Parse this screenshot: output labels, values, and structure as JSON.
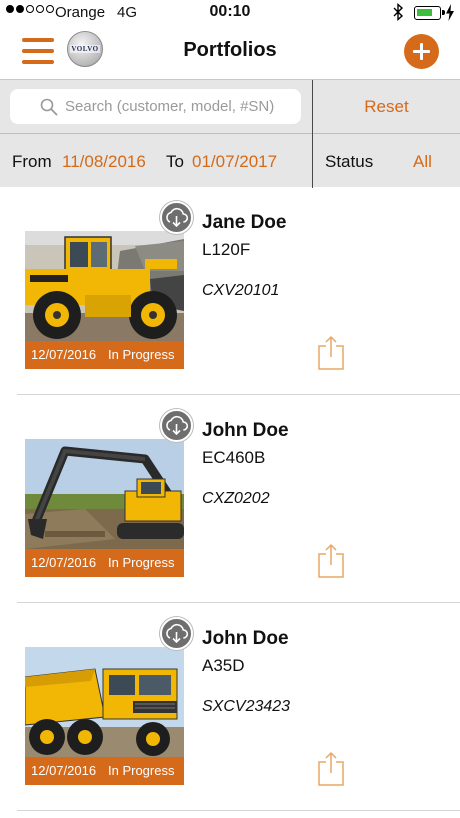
{
  "status_bar": {
    "carrier": "Orange",
    "network": "4G",
    "time": "00:10",
    "signal_bars_filled": 2,
    "signal_bars_total": 5,
    "battery_level": 0.7,
    "icons": [
      "signal-icon",
      "bluetooth-icon",
      "battery-icon",
      "charging-icon"
    ]
  },
  "header": {
    "title": "Portfolios",
    "logo_text": "VOLVO",
    "icons": [
      "menu-icon",
      "volvo-logo",
      "add-icon"
    ]
  },
  "filters": {
    "search_placeholder": "Search (customer, model, #SN)",
    "search_value": "",
    "reset_label": "Reset",
    "from_label": "From",
    "from_date": "11/08/2016",
    "to_label": "To",
    "to_date": "01/07/2017",
    "status_label": "Status",
    "status_value": "All"
  },
  "portfolios": [
    {
      "customer": "Jane Doe",
      "model": "L120F",
      "serial": "CXV20101",
      "date": "12/07/2016",
      "status": "In Progress",
      "machine": "wheel-loader"
    },
    {
      "customer": "John Doe",
      "model": "EC460B",
      "serial": "CXZ0202",
      "date": "12/07/2016",
      "status": "In Progress",
      "machine": "excavator"
    },
    {
      "customer": "John Doe",
      "model": "A35D",
      "serial": "SXCV23423",
      "date": "12/07/2016",
      "status": "In Progress",
      "machine": "articulated-hauler"
    }
  ],
  "colors": {
    "accent": "#d46a1a",
    "filter_bg": "#e6e6e6",
    "machine_yellow": "#f2b705",
    "battery_green": "#3bbf3b"
  }
}
